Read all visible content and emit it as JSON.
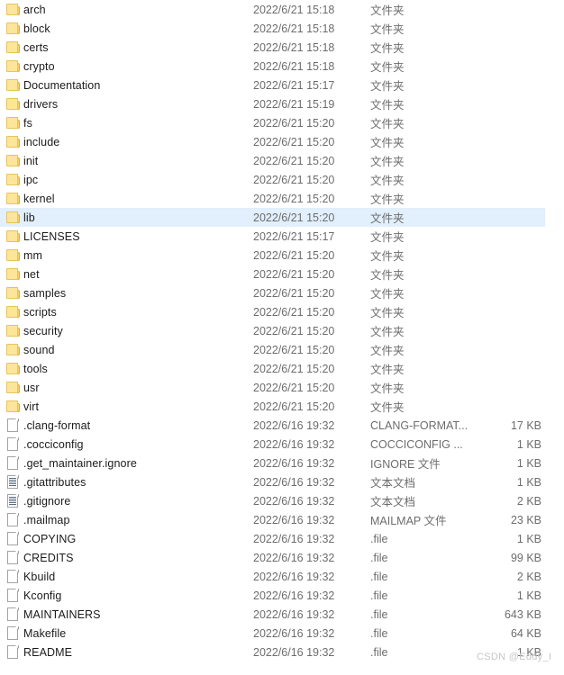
{
  "watermark": {
    "text": "CSDN @Eddy_I"
  },
  "file_list": {
    "selected_index": 11,
    "columns": [
      "name",
      "date_modified",
      "type",
      "size"
    ],
    "rows": [
      {
        "icon": "folder-icon",
        "name": "arch",
        "date": "2022/6/21 15:18",
        "type": "文件夹",
        "size": ""
      },
      {
        "icon": "folder-icon",
        "name": "block",
        "date": "2022/6/21 15:18",
        "type": "文件夹",
        "size": ""
      },
      {
        "icon": "folder-icon",
        "name": "certs",
        "date": "2022/6/21 15:18",
        "type": "文件夹",
        "size": ""
      },
      {
        "icon": "folder-icon",
        "name": "crypto",
        "date": "2022/6/21 15:18",
        "type": "文件夹",
        "size": ""
      },
      {
        "icon": "folder-icon",
        "name": "Documentation",
        "date": "2022/6/21 15:17",
        "type": "文件夹",
        "size": ""
      },
      {
        "icon": "folder-icon",
        "name": "drivers",
        "date": "2022/6/21 15:19",
        "type": "文件夹",
        "size": ""
      },
      {
        "icon": "folder-icon",
        "name": "fs",
        "date": "2022/6/21 15:20",
        "type": "文件夹",
        "size": ""
      },
      {
        "icon": "folder-icon",
        "name": "include",
        "date": "2022/6/21 15:20",
        "type": "文件夹",
        "size": ""
      },
      {
        "icon": "folder-icon",
        "name": "init",
        "date": "2022/6/21 15:20",
        "type": "文件夹",
        "size": ""
      },
      {
        "icon": "folder-icon",
        "name": "ipc",
        "date": "2022/6/21 15:20",
        "type": "文件夹",
        "size": ""
      },
      {
        "icon": "folder-icon",
        "name": "kernel",
        "date": "2022/6/21 15:20",
        "type": "文件夹",
        "size": ""
      },
      {
        "icon": "folder-icon",
        "name": "lib",
        "date": "2022/6/21 15:20",
        "type": "文件夹",
        "size": ""
      },
      {
        "icon": "folder-icon",
        "name": "LICENSES",
        "date": "2022/6/21 15:17",
        "type": "文件夹",
        "size": ""
      },
      {
        "icon": "folder-icon",
        "name": "mm",
        "date": "2022/6/21 15:20",
        "type": "文件夹",
        "size": ""
      },
      {
        "icon": "folder-icon",
        "name": "net",
        "date": "2022/6/21 15:20",
        "type": "文件夹",
        "size": ""
      },
      {
        "icon": "folder-icon",
        "name": "samples",
        "date": "2022/6/21 15:20",
        "type": "文件夹",
        "size": ""
      },
      {
        "icon": "folder-icon",
        "name": "scripts",
        "date": "2022/6/21 15:20",
        "type": "文件夹",
        "size": ""
      },
      {
        "icon": "folder-icon",
        "name": "security",
        "date": "2022/6/21 15:20",
        "type": "文件夹",
        "size": ""
      },
      {
        "icon": "folder-icon",
        "name": "sound",
        "date": "2022/6/21 15:20",
        "type": "文件夹",
        "size": ""
      },
      {
        "icon": "folder-icon",
        "name": "tools",
        "date": "2022/6/21 15:20",
        "type": "文件夹",
        "size": ""
      },
      {
        "icon": "folder-icon",
        "name": "usr",
        "date": "2022/6/21 15:20",
        "type": "文件夹",
        "size": ""
      },
      {
        "icon": "folder-icon",
        "name": "virt",
        "date": "2022/6/21 15:20",
        "type": "文件夹",
        "size": ""
      },
      {
        "icon": "file-icon",
        "name": ".clang-format",
        "date": "2022/6/16 19:32",
        "type": "CLANG-FORMAT...",
        "size": "17 KB"
      },
      {
        "icon": "file-icon",
        "name": ".cocciconfig",
        "date": "2022/6/16 19:32",
        "type": "COCCICONFIG ...",
        "size": "1 KB"
      },
      {
        "icon": "file-icon",
        "name": ".get_maintainer.ignore",
        "date": "2022/6/16 19:32",
        "type": "IGNORE 文件",
        "size": "1 KB"
      },
      {
        "icon": "text-document-icon",
        "name": ".gitattributes",
        "date": "2022/6/16 19:32",
        "type": "文本文档",
        "size": "1 KB"
      },
      {
        "icon": "text-document-icon",
        "name": ".gitignore",
        "date": "2022/6/16 19:32",
        "type": "文本文档",
        "size": "2 KB"
      },
      {
        "icon": "file-icon",
        "name": ".mailmap",
        "date": "2022/6/16 19:32",
        "type": "MAILMAP 文件",
        "size": "23 KB"
      },
      {
        "icon": "file-icon",
        "name": "COPYING",
        "date": "2022/6/16 19:32",
        "type": ".file",
        "size": "1 KB"
      },
      {
        "icon": "file-icon",
        "name": "CREDITS",
        "date": "2022/6/16 19:32",
        "type": ".file",
        "size": "99 KB"
      },
      {
        "icon": "file-icon",
        "name": "Kbuild",
        "date": "2022/6/16 19:32",
        "type": ".file",
        "size": "2 KB"
      },
      {
        "icon": "file-icon",
        "name": "Kconfig",
        "date": "2022/6/16 19:32",
        "type": ".file",
        "size": "1 KB"
      },
      {
        "icon": "file-icon",
        "name": "MAINTAINERS",
        "date": "2022/6/16 19:32",
        "type": ".file",
        "size": "643 KB"
      },
      {
        "icon": "file-icon",
        "name": "Makefile",
        "date": "2022/6/16 19:32",
        "type": ".file",
        "size": "64 KB"
      },
      {
        "icon": "file-icon",
        "name": "README",
        "date": "2022/6/16 19:32",
        "type": ".file",
        "size": "1 KB"
      }
    ]
  },
  "colors": {
    "selection": "#e2effc",
    "folder_fill": "#fde69a",
    "folder_tab": "#f7cf6e",
    "text_primary": "#1b1b1b",
    "text_secondary": "#6d6d6d",
    "watermark": "#c7c7c7"
  }
}
